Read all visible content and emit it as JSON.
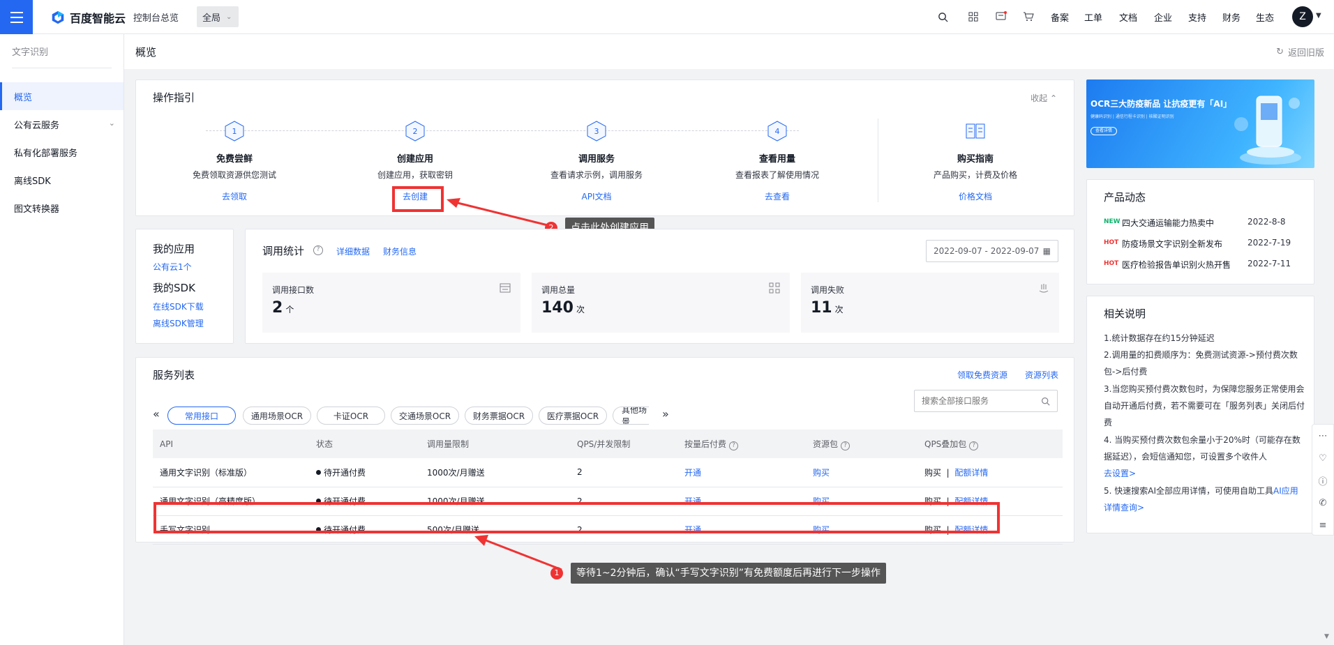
{
  "topbar": {
    "brand": "百度智能云",
    "console": "控制台总览",
    "region": "全局",
    "nav": [
      "备案",
      "工单",
      "文档",
      "企业",
      "支持",
      "财务",
      "生态"
    ],
    "avatar_letter": "Z",
    "icons": [
      "search-icon",
      "apps-icon",
      "message-icon",
      "cart-icon"
    ]
  },
  "sidebar": {
    "title": "文字识别",
    "items": [
      {
        "label": "概览",
        "active": true
      },
      {
        "label": "公有云服务",
        "expandable": true
      },
      {
        "label": "私有化部署服务"
      },
      {
        "label": "离线SDK"
      },
      {
        "label": "图文转换器"
      }
    ]
  },
  "page": {
    "title": "概览",
    "back_old": "返回旧版"
  },
  "guide": {
    "title": "操作指引",
    "collapse": "收起",
    "steps": [
      {
        "num": "1",
        "title": "免费尝鲜",
        "desc": "免费领取资源供您测试",
        "link": "去领取"
      },
      {
        "num": "2",
        "title": "创建应用",
        "desc": "创建应用，获取密钥",
        "link": "去创建"
      },
      {
        "num": "3",
        "title": "调用服务",
        "desc": "查看请求示例，调用服务",
        "link": "API文档"
      },
      {
        "num": "4",
        "title": "查看用量",
        "desc": "查看报表了解使用情况",
        "link": "去查看"
      },
      {
        "num": "",
        "title": "购买指南",
        "desc": "产品购买，计费及价格",
        "link": "价格文档"
      }
    ]
  },
  "annotations": {
    "callout2_num": "2",
    "callout2_text": "点击此处创建应用",
    "callout1_num": "1",
    "callout1_text": "等待1~2分钟后，确认“手写文字识别”有免费额度后再进行下一步操作"
  },
  "myapps": {
    "apps_title": "我的应用",
    "apps_link": "公有云1个",
    "sdk_title": "我的SDK",
    "sdk_online": "在线SDK下载",
    "sdk_offline": "离线SDK管理"
  },
  "stats": {
    "title": "调用统计",
    "detail_link": "详细数据",
    "finance_link": "财务信息",
    "date_range": "2022-09-07 - 2022-09-07",
    "cards": [
      {
        "label": "调用接口数",
        "value": "2",
        "unit": "个",
        "icon": "api-list-icon"
      },
      {
        "label": "调用总量",
        "value": "140",
        "unit": "次",
        "icon": "grid-icon"
      },
      {
        "label": "调用失败",
        "value": "11",
        "unit": "次",
        "icon": "failure-icon"
      }
    ]
  },
  "services": {
    "title": "服务列表",
    "free_link": "领取免费资源",
    "resource_link": "资源列表",
    "search_placeholder": "搜索全部接口服务",
    "tabs": [
      "常用接口",
      "通用场景OCR",
      "卡证OCR",
      "交通场景OCR",
      "财务票据OCR",
      "医疗票据OCR",
      "其他场景"
    ],
    "columns": [
      "API",
      "状态",
      "调用量限制",
      "QPS/并发限制",
      "按量后付费",
      "资源包",
      "QPS叠加包"
    ],
    "rows": [
      {
        "api": "通用文字识别（标准版）",
        "status": "待开通付费",
        "limit": "1000次/月赠送",
        "qps": "2",
        "postpay": "开通",
        "package": "购买",
        "qps_buy": "购买",
        "qps_detail": "配额详情"
      },
      {
        "api": "通用文字识别（高精度版）",
        "status": "待开通付费",
        "limit": "1000次/月赠送",
        "qps": "2",
        "postpay": "开通",
        "package": "购买",
        "qps_buy": "购买",
        "qps_detail": "配额详情"
      },
      {
        "api": "手写文字识别",
        "status": "待开通付费",
        "limit": "500次/月赠送",
        "qps": "2",
        "postpay": "开通",
        "package": "购买",
        "qps_buy": "购买",
        "qps_detail": "配额详情"
      }
    ]
  },
  "banner": {
    "headline": "OCR三大防疫新品 让抗疫更有「AI」",
    "sub": "健康码识别 | 通信行程卡识别 | 核酸证明识别",
    "button": "查看详情"
  },
  "news": {
    "title": "产品动态",
    "items": [
      {
        "tag": "NEW",
        "text": "四大交通运输能力热卖中",
        "date": "2022-8-8"
      },
      {
        "tag": "HOT",
        "text": "防疫场景文字识别全新发布",
        "date": "2022-7-19"
      },
      {
        "tag": "HOT",
        "text": "医疗检验报告单识别火热开售",
        "date": "2022-7-11"
      }
    ]
  },
  "notes": {
    "title": "相关说明",
    "n1": "1.统计数据存在约15分钟延迟",
    "n2": "2.调用量的扣费顺序为：免费测试资源->预付费次数包->后付费",
    "n3": "3.当您购买预付费次数包时，为保障您服务正常使用会自动开通后付费，若不需要可在「服务列表」关闭后付费",
    "n4": "4. 当购买预付费次数包余量小于20%时（可能存在数据延迟），会短信通知您，可设置多个收件人",
    "n4_link": "去设置>",
    "n5": "5. 快速搜索AI全部应用详情，可使用自助工具",
    "n5_link": "AI应用详情查询>"
  },
  "colors": {
    "primary": "#2468f2",
    "annotation_red": "#ef3333",
    "new_tag": "#0bb36b",
    "hot_tag": "#ef3333"
  }
}
